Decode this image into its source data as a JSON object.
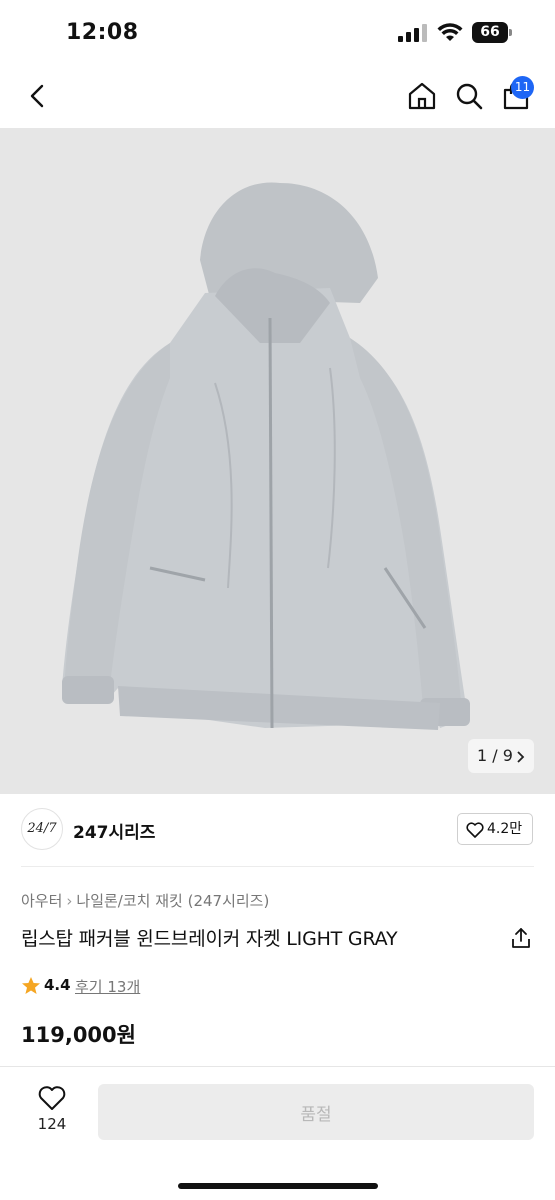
{
  "status_bar": {
    "time": "12:08",
    "battery": "66",
    "icons": [
      "signal-icon",
      "wifi-icon",
      "battery-icon"
    ]
  },
  "nav": {
    "icons": [
      "back-chevron-icon",
      "home-icon",
      "search-icon",
      "shopping-bag-icon"
    ],
    "cart_badge": "11"
  },
  "gallery": {
    "counter": "1 / 9",
    "image_subject": "light gray hooded zip-up windbreaker jacket",
    "background_color": "#e6e6e6"
  },
  "brand": {
    "logo_text": "24/7",
    "name": "247시리즈",
    "like_count": "4.2만"
  },
  "product": {
    "breadcrumb": [
      "아우터",
      "나일론/코치 재킷 (247시리즈)"
    ],
    "title": "립스탑 패커블 윈드브레이커 자켓 LIGHT GRAY",
    "rating": "4.4",
    "reviews": "후기 13개",
    "price": "119,000원"
  },
  "bottom_bar": {
    "wish_count": "124",
    "action_label": "품절"
  },
  "colors": {
    "accent_badge": "#1e66f5",
    "star": "#f5a623",
    "disabled_button": "#ececec"
  }
}
